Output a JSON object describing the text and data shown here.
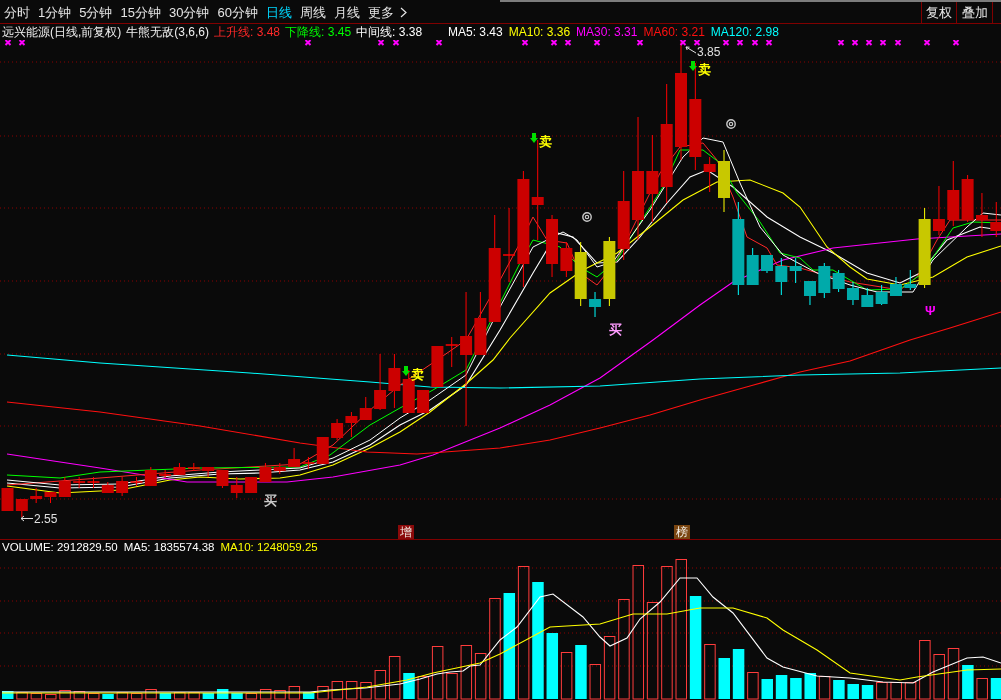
{
  "period_tabs": [
    {
      "label": "分时",
      "kind": "period",
      "selected": false
    },
    {
      "label": "1分钟",
      "kind": "period",
      "selected": false
    },
    {
      "label": "5分钟",
      "kind": "period",
      "selected": false
    },
    {
      "label": "15分钟",
      "kind": "period",
      "selected": false
    },
    {
      "label": "30分钟",
      "kind": "period",
      "selected": false
    },
    {
      "label": "60分钟",
      "kind": "period",
      "selected": false
    },
    {
      "label": "日线",
      "kind": "period",
      "selected": true
    },
    {
      "label": "周线",
      "kind": "period",
      "selected": false
    },
    {
      "label": "月线",
      "kind": "period",
      "selected": false
    },
    {
      "label": "更多",
      "kind": "more",
      "selected": false
    }
  ],
  "toolbar_buttons": [
    "复权",
    "叠加"
  ],
  "price_panel": {
    "title": "远兴能源(日线,前复权)",
    "indicator": "牛熊无敌(3,6,6)",
    "indicator_lines": [
      {
        "label": "上升线: 3.48",
        "color": "#ff2828"
      },
      {
        "label": "下降线: 3.45",
        "color": "#00ff00"
      },
      {
        "label": "中间线: 3.38",
        "color": "#ffffff"
      }
    ],
    "moving_averages": [
      {
        "label": "MA5: 3.43",
        "color": "#ffffff"
      },
      {
        "label": "MA10: 3.36",
        "color": "#ffff00"
      },
      {
        "label": "MA30: 3.31",
        "color": "#ff00ff"
      },
      {
        "label": "MA60: 3.21",
        "color": "#ff1010"
      },
      {
        "label": "MA120: 2.98",
        "color": "#00ffff"
      }
    ],
    "high_label": "3.85",
    "low_label": "2.55",
    "signals": [
      {
        "kind": "buy",
        "text": "买",
        "color": "#c8c8c8"
      },
      {
        "kind": "sell",
        "text": "卖",
        "color": "#ffff00"
      },
      {
        "kind": "sell",
        "text": "卖",
        "color": "#ffff00"
      },
      {
        "kind": "buy",
        "text": "买",
        "color": "#ff9cff"
      },
      {
        "kind": "sell",
        "text": "卖",
        "color": "#ffff00"
      },
      {
        "kind": "mark",
        "text": "Ψ",
        "color": "#ff00ff"
      }
    ],
    "badges": [
      {
        "text": "增",
        "color": "#8b0a0a"
      },
      {
        "text": "榜",
        "color": "#7a4510"
      }
    ]
  },
  "volume_panel": {
    "legend": [
      {
        "label": "VOLUME: 2912829.50",
        "color": "#ffffff"
      },
      {
        "label": "MA5: 1835574.38",
        "color": "#ffffff"
      },
      {
        "label": "MA10: 1248059.25",
        "color": "#ffff00"
      }
    ]
  }
}
